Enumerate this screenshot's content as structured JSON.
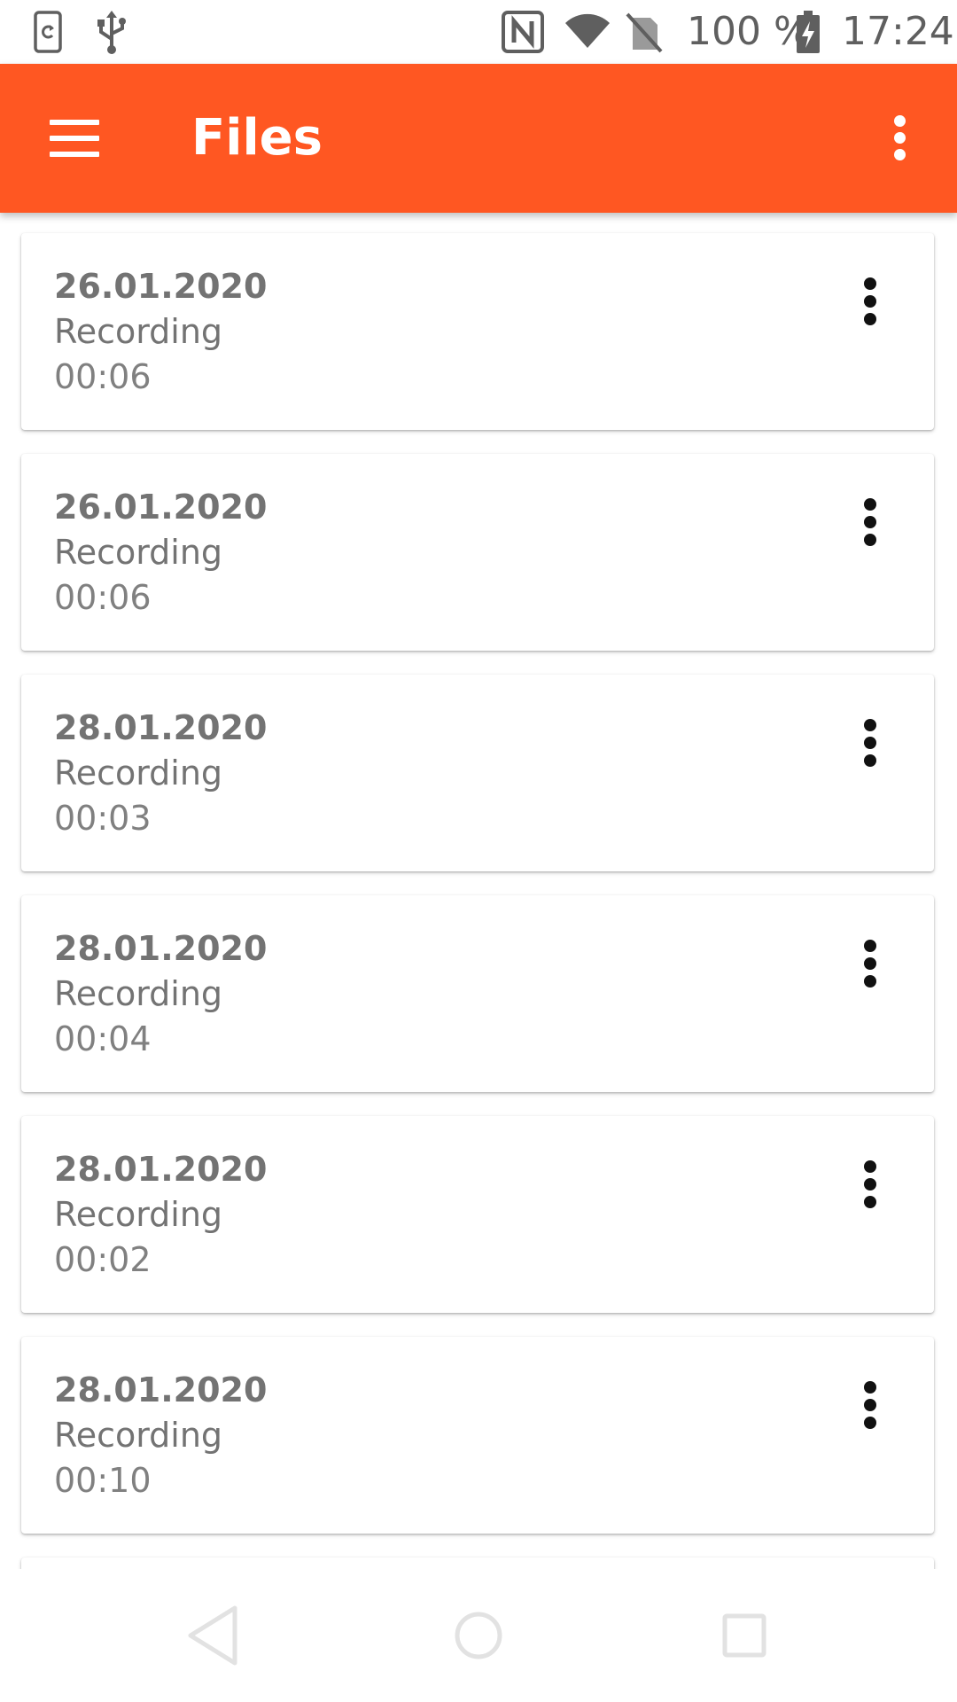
{
  "status_bar": {
    "battery_text": "100 %",
    "time": "17:24",
    "left_icons": [
      "screen-rotation-icon",
      "usb-icon"
    ],
    "right_icons": [
      "nfc-icon",
      "wifi-icon",
      "no-sim-icon",
      "battery-charging-icon"
    ]
  },
  "app_bar": {
    "title": "Files",
    "background_color": "#ff5722",
    "menu_icon": "hamburger-menu-icon",
    "overflow_icon": "more-vert-icon"
  },
  "files": [
    {
      "date": "26.01.2020",
      "name": "Recording",
      "duration": "00:06"
    },
    {
      "date": "26.01.2020",
      "name": "Recording",
      "duration": "00:06"
    },
    {
      "date": "28.01.2020",
      "name": "Recording",
      "duration": "00:03"
    },
    {
      "date": "28.01.2020",
      "name": "Recording",
      "duration": "00:04"
    },
    {
      "date": "28.01.2020",
      "name": "Recording",
      "duration": "00:02"
    },
    {
      "date": "28.01.2020",
      "name": "Recording",
      "duration": "00:10"
    }
  ],
  "nav_bar": {
    "icons": [
      "back-icon",
      "home-icon",
      "recents-icon"
    ]
  }
}
